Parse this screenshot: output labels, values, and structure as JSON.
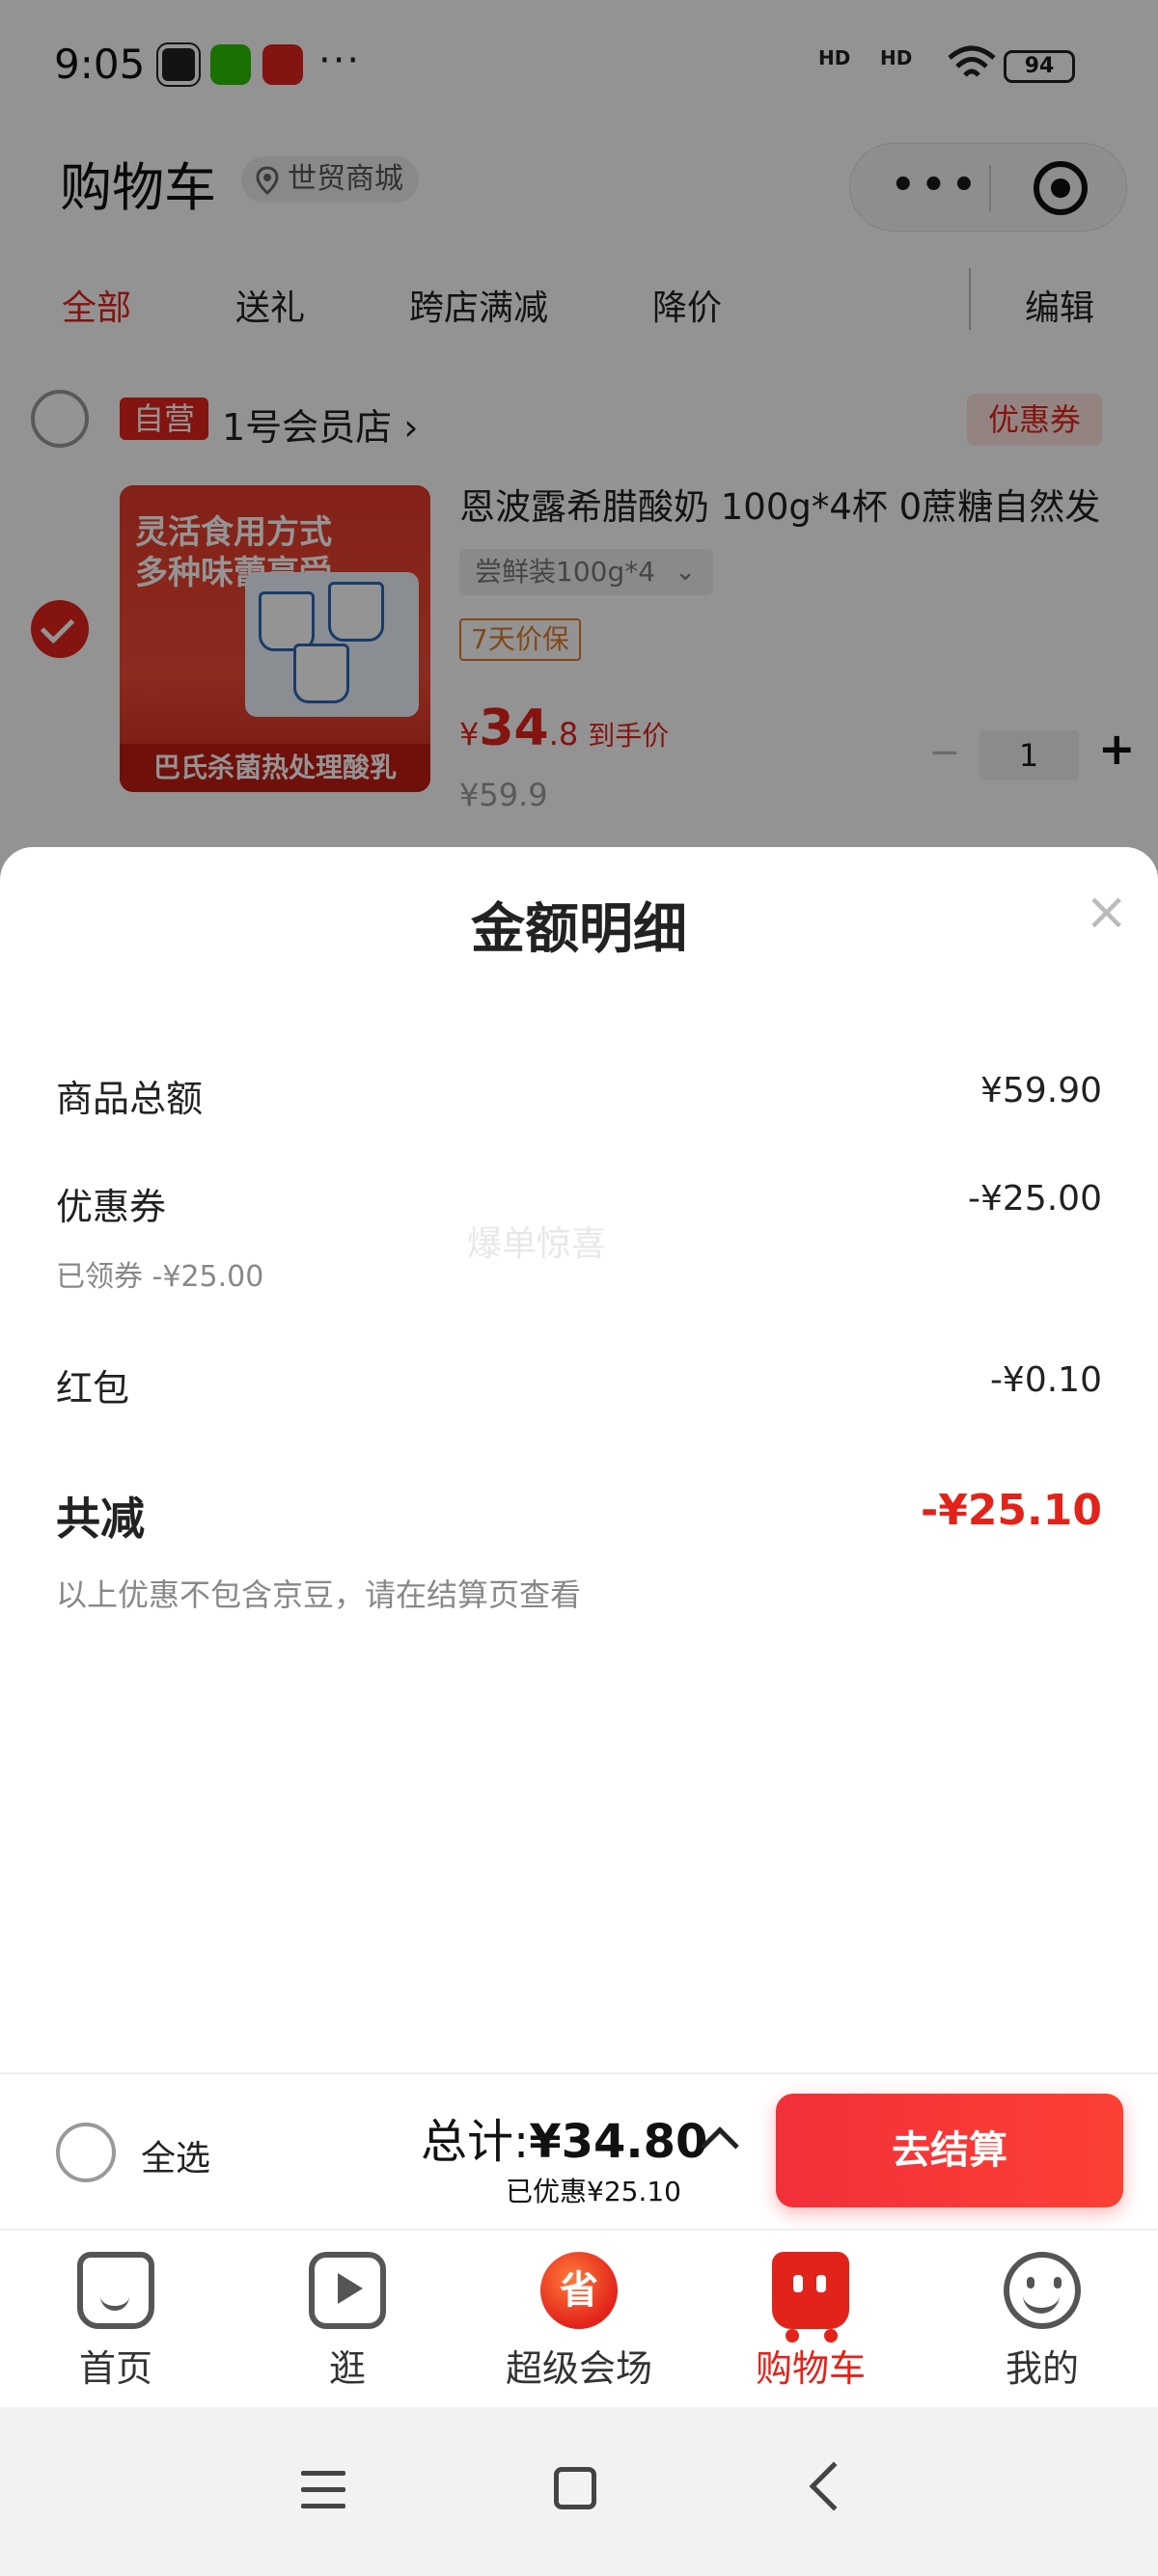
{
  "status_bar": {
    "time": "9:05",
    "signal_1": "HD",
    "signal_2": "HD",
    "battery": "94"
  },
  "header": {
    "title": "购物车",
    "location": "世贸商城",
    "capsule_more_icon": "more-dots-icon",
    "capsule_target_icon": "target-icon"
  },
  "tabs": [
    {
      "label": "全部",
      "active": true
    },
    {
      "label": "送礼"
    },
    {
      "label": "跨店满减"
    },
    {
      "label": "降价"
    }
  ],
  "edit_label": "编辑",
  "shop": {
    "tag": "自营",
    "name": "1号会员店",
    "arrow": "›",
    "coupon": "优惠券"
  },
  "product": {
    "title": "恩波露希腊酸奶 100g*4杯 0蔗糖自然发",
    "spec": "尝鲜装100g*4",
    "spec_chevron": "⌄",
    "guarantee": "7天价保",
    "price_currency": "¥",
    "price_big": "34",
    "price_small": ".8",
    "price_note": "到手价",
    "original_price": "¥59.9",
    "quantity": "1",
    "minus": "−",
    "plus": "+",
    "image_headline_1": "灵活食用方式",
    "image_headline_2": "多种味蕾享受",
    "image_bottom": "巴氏杀菌热处理酸乳"
  },
  "sheet": {
    "title": "金额明细",
    "close": "×",
    "rows": [
      {
        "label": "商品总额",
        "value": "¥59.90"
      },
      {
        "label": "优惠券",
        "value": "-¥25.00",
        "sub": "已领券 -¥25.00"
      },
      {
        "label": "红包",
        "value": "-¥0.10"
      }
    ],
    "watermark": "爆单惊喜",
    "total_label": "共减",
    "total_value": "-¥25.10",
    "total_note": "以上优惠不包含京豆，请在结算页查看"
  },
  "checkout": {
    "select_all": "全选",
    "total_prefix": "总计:",
    "total_amount": "¥34.80",
    "saved": "已优惠¥25.10",
    "button": "去结算"
  },
  "tabbar": [
    {
      "label": "首页",
      "icon": "home-icon"
    },
    {
      "label": "逛",
      "icon": "play-icon"
    },
    {
      "label": "超级会场",
      "icon": "super-venue-icon",
      "glyph": "省"
    },
    {
      "label": "购物车",
      "icon": "cart-icon",
      "active": true
    },
    {
      "label": "我的",
      "icon": "smile-icon"
    }
  ],
  "colors": {
    "accent": "#e2231a",
    "dim_overlay": "rgba(0,0,0,0.42)"
  }
}
